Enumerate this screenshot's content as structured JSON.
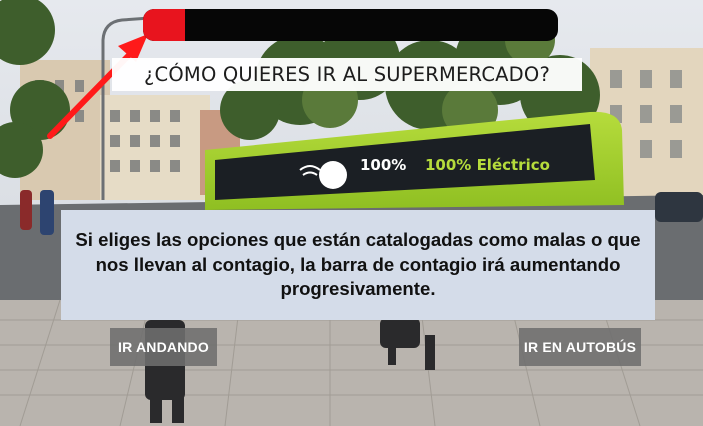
{
  "game": {
    "contagion_level": 0.1,
    "question": "¿CÓMO QUIERES IR AL SUPERMERCADO?",
    "info_text": "Si eliges las opciones que están catalogadas como malas o que nos llevan al contagio, la barra de contagio irá aumentando progresivamente.",
    "bus_sign_text": "100% Eléctrico",
    "choices": {
      "walk": "IR ANDANDO",
      "bus": "IR EN AUTOBÚS"
    }
  },
  "colors": {
    "bar_fill": "#e8141e",
    "bar_track": "#060606",
    "arrow": "#ff1a1a",
    "panel": "#d4dce9",
    "button": "#6e6e6e"
  }
}
